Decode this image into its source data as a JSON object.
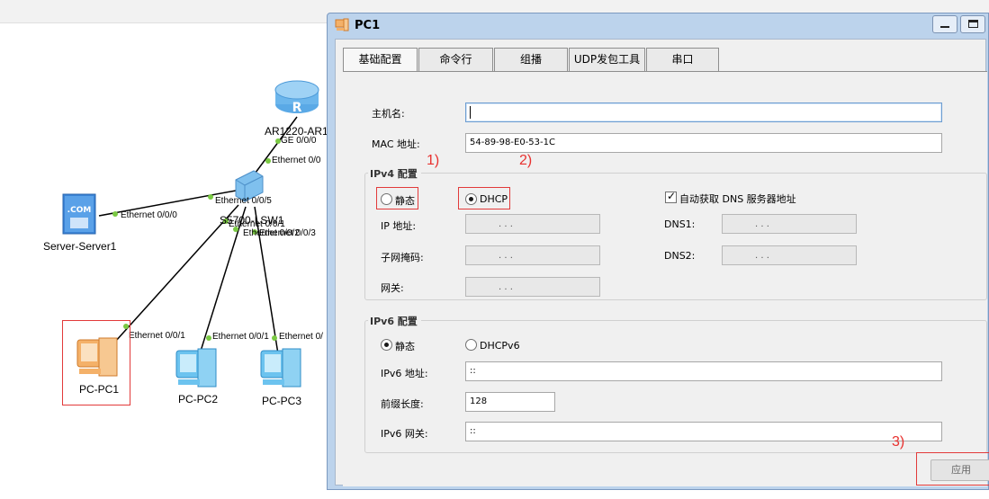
{
  "topology": {
    "devices": {
      "router": "AR1220-AR1",
      "switch": "S5700-LSW1",
      "server": "Server-Server1",
      "pc1": "PC-PC1",
      "pc2": "PC-PC2",
      "pc3": "PC-PC3"
    },
    "icon_text": {
      "router": "R",
      "server": ".COM"
    },
    "ports": {
      "router_ge": "GE 0/0/0",
      "sw_to_router": "Ethernet 0/0",
      "sw_to_server": "Ethernet 0/0/5",
      "server_port": "Ethernet 0/0/0",
      "sw_p1": "Ethernet 0/0/1",
      "sw_p2": "Ethernet 0/0/2",
      "sw_p3": "Ethernet 0/0/3",
      "pc1_port": "Ethernet 0/0/1",
      "pc2_port": "Ethernet 0/0/1",
      "pc3_port": "Ethernet 0/"
    }
  },
  "window": {
    "title": "PC1",
    "tabs": [
      "基础配置",
      "命令行",
      "组播",
      "UDP发包工具",
      "串口"
    ],
    "active_tab": 0
  },
  "form": {
    "hostname_label": "主机名:",
    "hostname_value": "",
    "mac_label": "MAC 地址:",
    "mac_value": "54-89-98-E0-53-1C",
    "ipv4": {
      "title": "IPv4 配置",
      "static_label": "静态",
      "dhcp_label": "DHCP",
      "auto_dns_label": "自动获取 DNS 服务器地址",
      "ip_label": "IP 地址:",
      "mask_label": "子网掩码:",
      "gateway_label": "网关:",
      "dns1_label": "DNS1:",
      "dns2_label": "DNS2:",
      "ip_dots": ".    .    .",
      "selected": "DHCP",
      "auto_dns_checked": true
    },
    "ipv6": {
      "title": "IPv6 配置",
      "static_label": "静态",
      "dhcpv6_label": "DHCPv6",
      "addr_label": "IPv6 地址:",
      "addr_value": "::",
      "prefix_label": "前缀长度:",
      "prefix_value": "128",
      "gw_label": "IPv6 网关:",
      "gw_value": "::",
      "selected": "静态"
    },
    "apply_label": "应用"
  },
  "annotations": {
    "a1": "1)",
    "a2": "2)",
    "a3": "3)"
  },
  "colors": {
    "annotation_red": "#e8312f",
    "link_dot": "#7ac943",
    "window_frame": "#bcd3ec"
  }
}
